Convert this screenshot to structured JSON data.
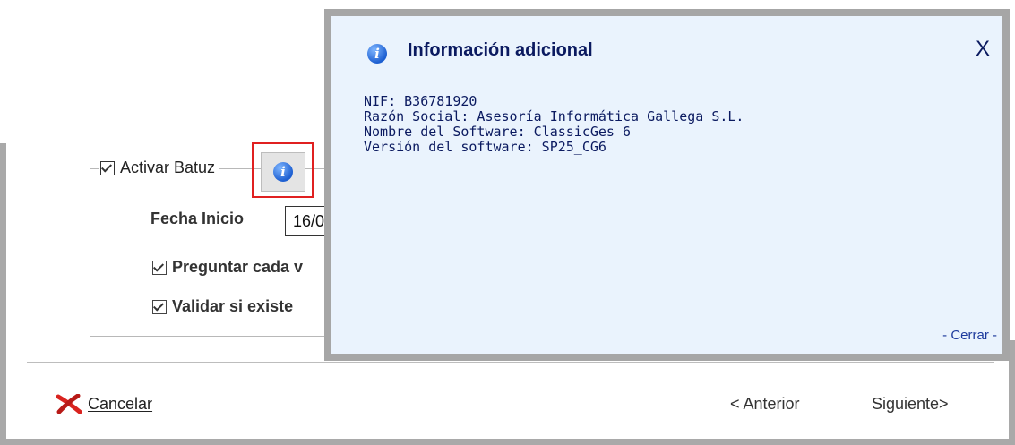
{
  "main": {
    "activar_label": "Activar Batuz",
    "fecha_label": "Fecha Inicio",
    "fecha_value": "16/0",
    "option1": "Preguntar cada v",
    "option2": "Validar si existe"
  },
  "footer": {
    "cancel_label": "Cancelar",
    "prev_label": "< Anterior",
    "next_label": "Siguiente>"
  },
  "popup": {
    "title": "Información adicional",
    "close_x": "X",
    "lines": [
      "NIF: B36781920",
      "Razón Social: Asesoría Informática Gallega S.L.",
      "Nombre del Software: ClassicGes 6",
      "Versión del software: SP25_CG6"
    ],
    "footer_close": "- Cerrar -"
  },
  "icons": {
    "info": "info-icon",
    "cancel": "red-x-icon"
  },
  "colors": {
    "popup_bg": "#eaf3fd",
    "popup_text": "#0b1a60",
    "highlight": "#e02020"
  }
}
